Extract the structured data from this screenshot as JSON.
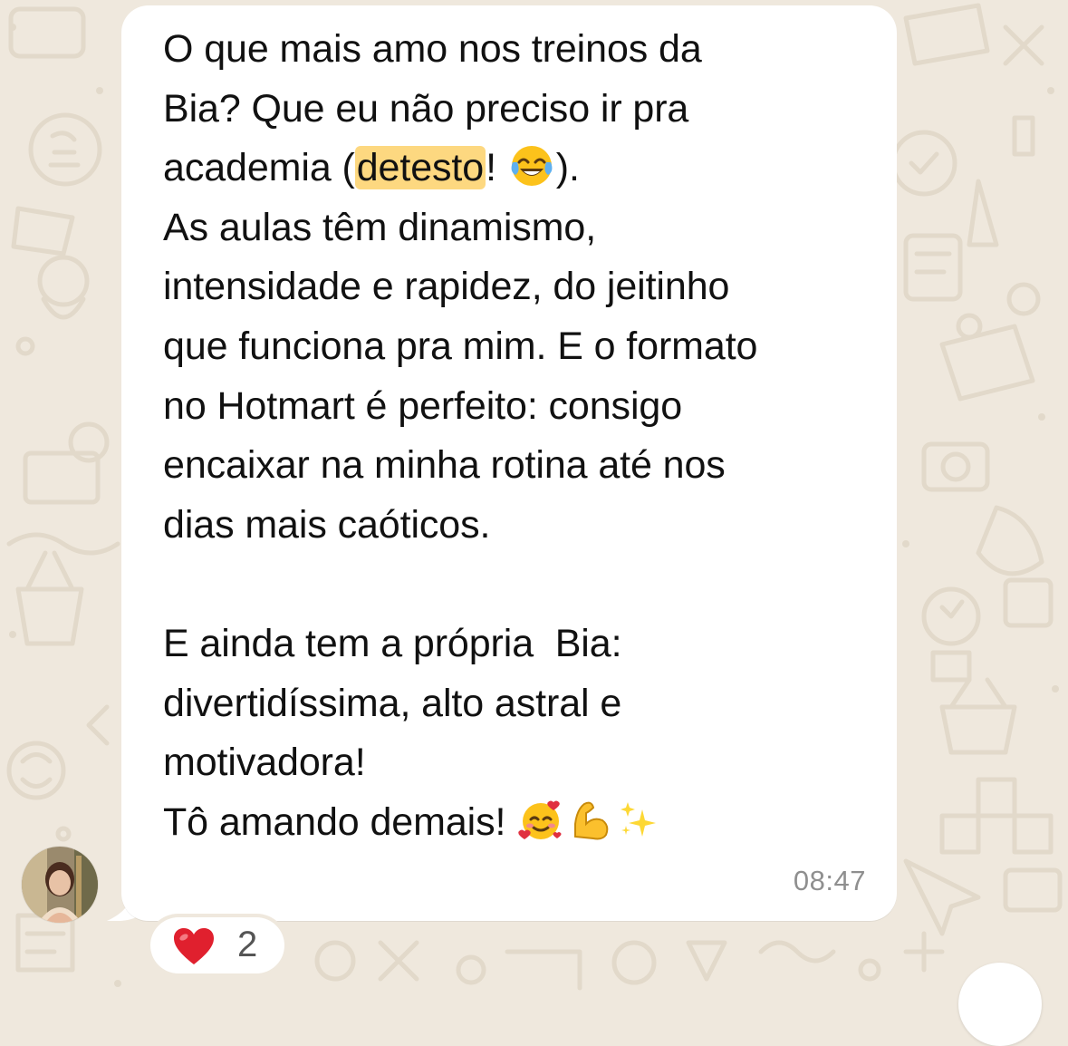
{
  "chat": {
    "wallpaper": "whatsapp-doodle-pattern",
    "colors": {
      "background": "#efe8dd",
      "bubble": "#ffffff",
      "highlight": "#fdd880",
      "timestamp": "#8f8f8f"
    }
  },
  "message": {
    "sender_avatar": "avatar-photo",
    "lines": [
      [
        "O que mais amo nos treinos da"
      ],
      [
        "Bia? Que eu não preciso ir pra"
      ],
      [
        "academia (",
        "detesto",
        "! ",
        "😂",
        ")."
      ],
      [
        "As aulas têm dinamismo,"
      ],
      [
        "intensidade e rapidez, do jeitinho"
      ],
      [
        "que funciona pra mim. E o formato"
      ],
      [
        "no Hotmart é perfeito: consigo"
      ],
      [
        "encaixar na minha rotina até nos"
      ],
      [
        "dias mais caóticos."
      ],
      [
        ""
      ],
      [
        "E ainda tem a própria  Bia:"
      ],
      [
        "divertidíssima, alto astral e"
      ],
      [
        "motivadora!"
      ],
      [
        "Tô amando demais! ",
        "🥰",
        "💪",
        "✨"
      ]
    ],
    "highlighted_word": "detesto",
    "timestamp": "08:47"
  },
  "reaction": {
    "icon": "heart-icon",
    "count": "2"
  },
  "scroll_button": {
    "icon": "chevron-down-icon"
  }
}
